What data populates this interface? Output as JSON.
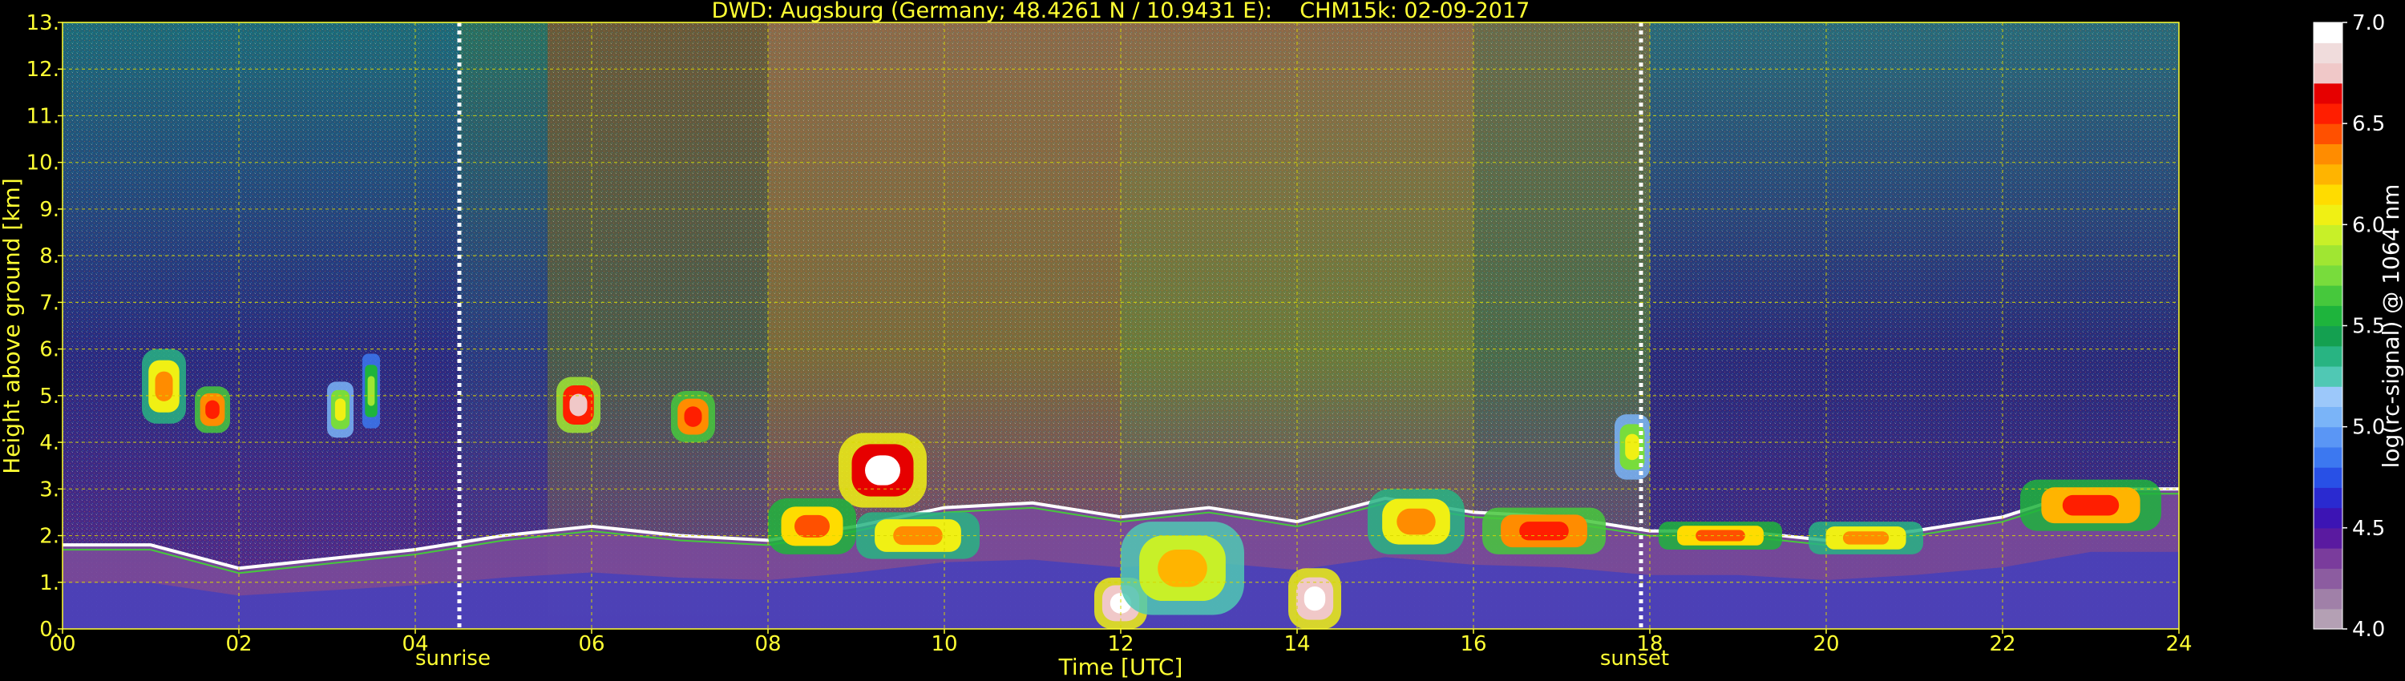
{
  "chart_data": {
    "type": "heatmap",
    "title": "DWD: Augsburg (Germany; 48.4261 N / 10.9431 E):    CHM15k: 02-09-2017",
    "xlabel": "Time [UTC]",
    "ylabel": "Height above ground [km]",
    "x_range": [
      0,
      24
    ],
    "y_range": [
      0,
      13
    ],
    "x_ticks": [
      "00",
      "02",
      "04",
      "06",
      "08",
      "10",
      "12",
      "14",
      "16",
      "18",
      "20",
      "22",
      "24"
    ],
    "y_ticks": [
      "0.",
      "1.",
      "2.",
      "3.",
      "4.",
      "5.",
      "6.",
      "7.",
      "8.",
      "9.",
      "10.",
      "11.",
      "12.",
      "13."
    ],
    "grid": true,
    "markers": [
      {
        "label": "sunrise",
        "time": 4.5
      },
      {
        "label": "sunset",
        "time": 17.9
      }
    ],
    "colorbar": {
      "label": "log(rc-signal) @ 1064 nm",
      "range": [
        4.0,
        7.0
      ],
      "ticks": [
        "4.0",
        "4.5",
        "5.0",
        "5.5",
        "6.0",
        "6.5",
        "7.0"
      ],
      "colors": [
        "#b4a0b4",
        "#a080a8",
        "#8c5ca0",
        "#7a3c9c",
        "#5a1aa0",
        "#3c14b4",
        "#2a2ad0",
        "#2850e6",
        "#3c78f0",
        "#5a96f5",
        "#7ab4f8",
        "#9cc8fa",
        "#50c8b4",
        "#28b482",
        "#14a050",
        "#1eb43c",
        "#46c83c",
        "#78dc3c",
        "#a0e632",
        "#c8f028",
        "#f0f014",
        "#ffdc00",
        "#ffb400",
        "#ff8c00",
        "#ff5000",
        "#ff1e00",
        "#e60000",
        "#f0c8c8",
        "#f0dcdc",
        "#ffffff"
      ]
    },
    "background_by_hour": [
      {
        "t": [
          0,
          4.5
        ],
        "upper": "#1e6a78",
        "mid": "#2a2a80",
        "low": "#5a2a8a"
      },
      {
        "t": [
          4.5,
          5.5
        ],
        "upper": "#2a7060",
        "mid": "#2a3a80",
        "low": "#5a2a8a"
      },
      {
        "t": [
          5.5,
          8
        ],
        "upper": "#6a5a3a",
        "mid": "#4a5a4a",
        "low": "#6a3a8a"
      },
      {
        "t": [
          8,
          12
        ],
        "upper": "#8a6a4a",
        "mid": "#7a6a3a",
        "low": "#6a3a8a"
      },
      {
        "t": [
          12,
          16
        ],
        "upper": "#8a6a4a",
        "mid": "#6a7a3a",
        "low": "#6a3a8a"
      },
      {
        "t": [
          16,
          18
        ],
        "upper": "#6a6a4a",
        "mid": "#4a6a4a",
        "low": "#6a3a8a"
      },
      {
        "t": [
          18,
          24
        ],
        "upper": "#2a6a78",
        "mid": "#2a2a7a",
        "low": "#4a2a8a"
      }
    ],
    "boundary_layer_top_km": [
      {
        "t": 0,
        "h": 1.8
      },
      {
        "t": 1,
        "h": 1.8
      },
      {
        "t": 2,
        "h": 1.3
      },
      {
        "t": 3,
        "h": 1.5
      },
      {
        "t": 4,
        "h": 1.7
      },
      {
        "t": 5,
        "h": 2.0
      },
      {
        "t": 6,
        "h": 2.2
      },
      {
        "t": 7,
        "h": 2.0
      },
      {
        "t": 8,
        "h": 1.9
      },
      {
        "t": 9,
        "h": 2.2
      },
      {
        "t": 10,
        "h": 2.6
      },
      {
        "t": 11,
        "h": 2.7
      },
      {
        "t": 12,
        "h": 2.4
      },
      {
        "t": 13,
        "h": 2.6
      },
      {
        "t": 14,
        "h": 2.3
      },
      {
        "t": 15,
        "h": 2.8
      },
      {
        "t": 16,
        "h": 2.5
      },
      {
        "t": 17,
        "h": 2.4
      },
      {
        "t": 18,
        "h": 2.1
      },
      {
        "t": 19,
        "h": 2.1
      },
      {
        "t": 20,
        "h": 1.9
      },
      {
        "t": 21,
        "h": 2.1
      },
      {
        "t": 22,
        "h": 2.4
      },
      {
        "t": 23,
        "h": 3.0
      },
      {
        "t": 24,
        "h": 3.0
      }
    ],
    "cloud_features": [
      {
        "t": [
          0.9,
          1.4
        ],
        "h": [
          4.4,
          6.0
        ],
        "level": 6.3
      },
      {
        "t": [
          1.5,
          1.9
        ],
        "h": [
          4.2,
          5.2
        ],
        "level": 6.6
      },
      {
        "t": [
          3.0,
          3.3
        ],
        "h": [
          4.1,
          5.3
        ],
        "level": 6.0
      },
      {
        "t": [
          3.4,
          3.6
        ],
        "h": [
          4.3,
          5.9
        ],
        "level": 5.8
      },
      {
        "t": [
          5.6,
          6.1
        ],
        "h": [
          4.2,
          5.4
        ],
        "level": 6.8
      },
      {
        "t": [
          6.9,
          7.4
        ],
        "h": [
          4.0,
          5.1
        ],
        "level": 6.6
      },
      {
        "t": [
          8.8,
          9.8
        ],
        "h": [
          2.6,
          4.2
        ],
        "level": 6.9
      },
      {
        "t": [
          8.0,
          9.0
        ],
        "h": [
          1.6,
          2.8
        ],
        "level": 6.4
      },
      {
        "t": [
          9.0,
          10.4
        ],
        "h": [
          1.5,
          2.5
        ],
        "level": 6.3
      },
      {
        "t": [
          11.7,
          12.3
        ],
        "h": [
          0.0,
          1.1
        ],
        "level": 7.0
      },
      {
        "t": [
          12.0,
          13.4
        ],
        "h": [
          0.3,
          2.3
        ],
        "level": 6.2
      },
      {
        "t": [
          13.9,
          14.5
        ],
        "h": [
          0.0,
          1.3
        ],
        "level": 7.0
      },
      {
        "t": [
          14.8,
          15.9
        ],
        "h": [
          1.6,
          3.0
        ],
        "level": 6.3
      },
      {
        "t": [
          16.1,
          17.5
        ],
        "h": [
          1.6,
          2.6
        ],
        "level": 6.6
      },
      {
        "t": [
          17.6,
          18.0
        ],
        "h": [
          3.2,
          4.6
        ],
        "level": 6.0
      },
      {
        "t": [
          18.1,
          19.5
        ],
        "h": [
          1.7,
          2.3
        ],
        "level": 6.4
      },
      {
        "t": [
          19.8,
          21.1
        ],
        "h": [
          1.6,
          2.3
        ],
        "level": 6.3
      },
      {
        "t": [
          22.2,
          23.8
        ],
        "h": [
          2.1,
          3.2
        ],
        "level": 6.5
      }
    ]
  }
}
